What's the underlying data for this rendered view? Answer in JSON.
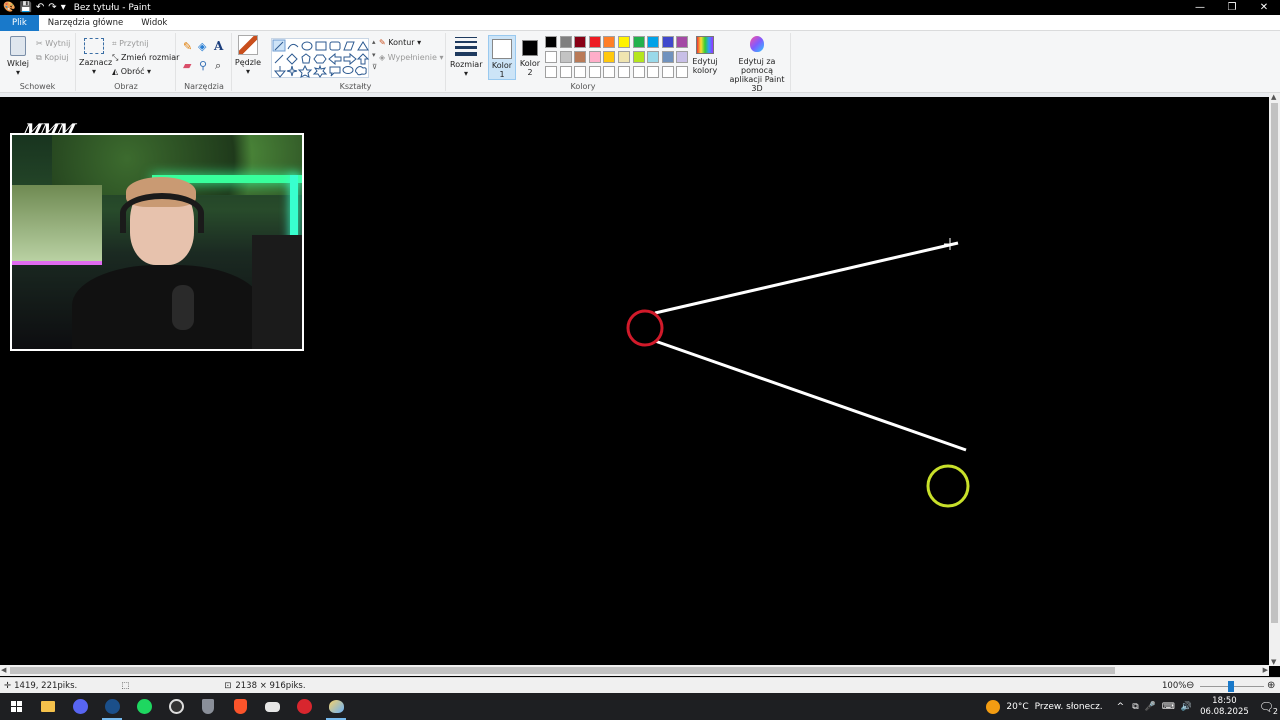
{
  "window": {
    "title": "Bez tytułu - Paint",
    "min_icon": "minimize-icon",
    "max_icon": "restore-icon",
    "close_icon": "close-icon"
  },
  "tabs": [
    {
      "label": "Plik"
    },
    {
      "label": "Narzędzia główne"
    },
    {
      "label": "Widok"
    }
  ],
  "ribbon": {
    "clipboard": {
      "paste": "Wklej",
      "cut": "Wytnij",
      "copy": "Kopiuj",
      "group": "Schowek"
    },
    "image": {
      "select": "Zaznacz",
      "crop": "Przytnij",
      "resize": "Zmień rozmiar",
      "rotate": "Obróć",
      "group": "Obraz"
    },
    "tools": {
      "group": "Narzędzia"
    },
    "brushes": {
      "label": "Pędzle"
    },
    "shapes": {
      "outline": "Kontur",
      "fill": "Wypełnienie",
      "group": "Kształty"
    },
    "size": {
      "label": "Rozmiar"
    },
    "colors": {
      "color1_line1": "Kolor",
      "color1_line2": "1",
      "color2_line1": "Kolor",
      "color2_line2": "2",
      "edit_line1": "Edytuj",
      "edit_line2": "kolory",
      "paint3d_line1": "Edytuj za pomocą",
      "paint3d_line2": "aplikacji Paint 3D",
      "group": "Kolory",
      "color1_value": "#ffffff",
      "color2_value": "#000000",
      "palette_row1": [
        "#000000",
        "#7f7f7f",
        "#880015",
        "#ed1c24",
        "#ff7f27",
        "#fff200",
        "#22b14c",
        "#00a2e8",
        "#3f48cc",
        "#a349a4"
      ],
      "palette_row2": [
        "#ffffff",
        "#c3c3c3",
        "#b97a57",
        "#ffaec9",
        "#ffc90e",
        "#efe4b0",
        "#b5e61d",
        "#99d9ea",
        "#7092be",
        "#c8bfe7"
      ],
      "palette_row3": [
        "#ffffff",
        "#ffffff",
        "#ffffff",
        "#ffffff",
        "#ffffff",
        "#ffffff",
        "#ffffff",
        "#ffffff",
        "#ffffff",
        "#ffffff"
      ]
    }
  },
  "canvas": {
    "background": "#000000",
    "line_color": "#ffffff",
    "red_circle_color": "#d11a2a",
    "yellow_circle_color": "#c8e02a"
  },
  "webcam": {
    "overlay_logo": "MMM"
  },
  "statusbar": {
    "cursor_pos": "1419, 221piks.",
    "image_size": "2138 × 916piks.",
    "zoom": "100%"
  },
  "taskbar": {
    "weather_temp": "20°C",
    "weather_text": "Przew. słonecz.",
    "time": "18:50",
    "date": "06.08.2025",
    "notif_count": "2"
  }
}
